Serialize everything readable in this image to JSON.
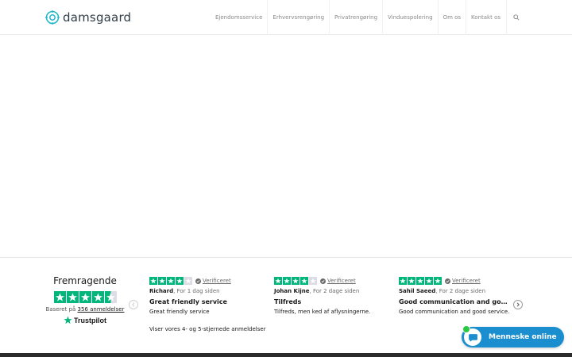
{
  "header": {
    "logo_text": "damsgaard",
    "nav": [
      {
        "label": "Ejendomsservice"
      },
      {
        "label": "Erhvervsrengøring"
      },
      {
        "label": "Privatrengøring"
      },
      {
        "label": "Vinduespolering"
      },
      {
        "label": "Om os"
      },
      {
        "label": "Kontakt os"
      }
    ],
    "search_icon": "search-icon"
  },
  "trustpilot": {
    "rating_word": "Fremragende",
    "stars": 4.5,
    "based_prefix": "Baseret på",
    "review_count": "356 anmeldelser",
    "brand": "Trustpilot",
    "reviews": [
      {
        "stars": 4,
        "verified": "Verificeret",
        "author": "Richard",
        "date": ", For 1 dag siden",
        "title": "Great friendly service",
        "text": "Great friendly service"
      },
      {
        "stars": 4,
        "verified": "Verificeret",
        "author": "Johan Kijne",
        "date": ", For 2 dage siden",
        "title": "Tilfreds",
        "text": "Tilfreds, men ked af aflysningerne."
      },
      {
        "stars": 5,
        "verified": "Verificeret",
        "author": "Sahil Saeed",
        "date": ", For 2 dage siden",
        "title": "Good communication and good service.",
        "text": "Good communication and good service."
      }
    ],
    "footnote": "Viser vores 4- og 5-stjernede anmeldelser"
  },
  "chat": {
    "label": "Menneske online"
  },
  "colors": {
    "brand": "#1b8ecf",
    "trustpilot_green": "#00b67a",
    "star_empty": "#dcdce6"
  }
}
